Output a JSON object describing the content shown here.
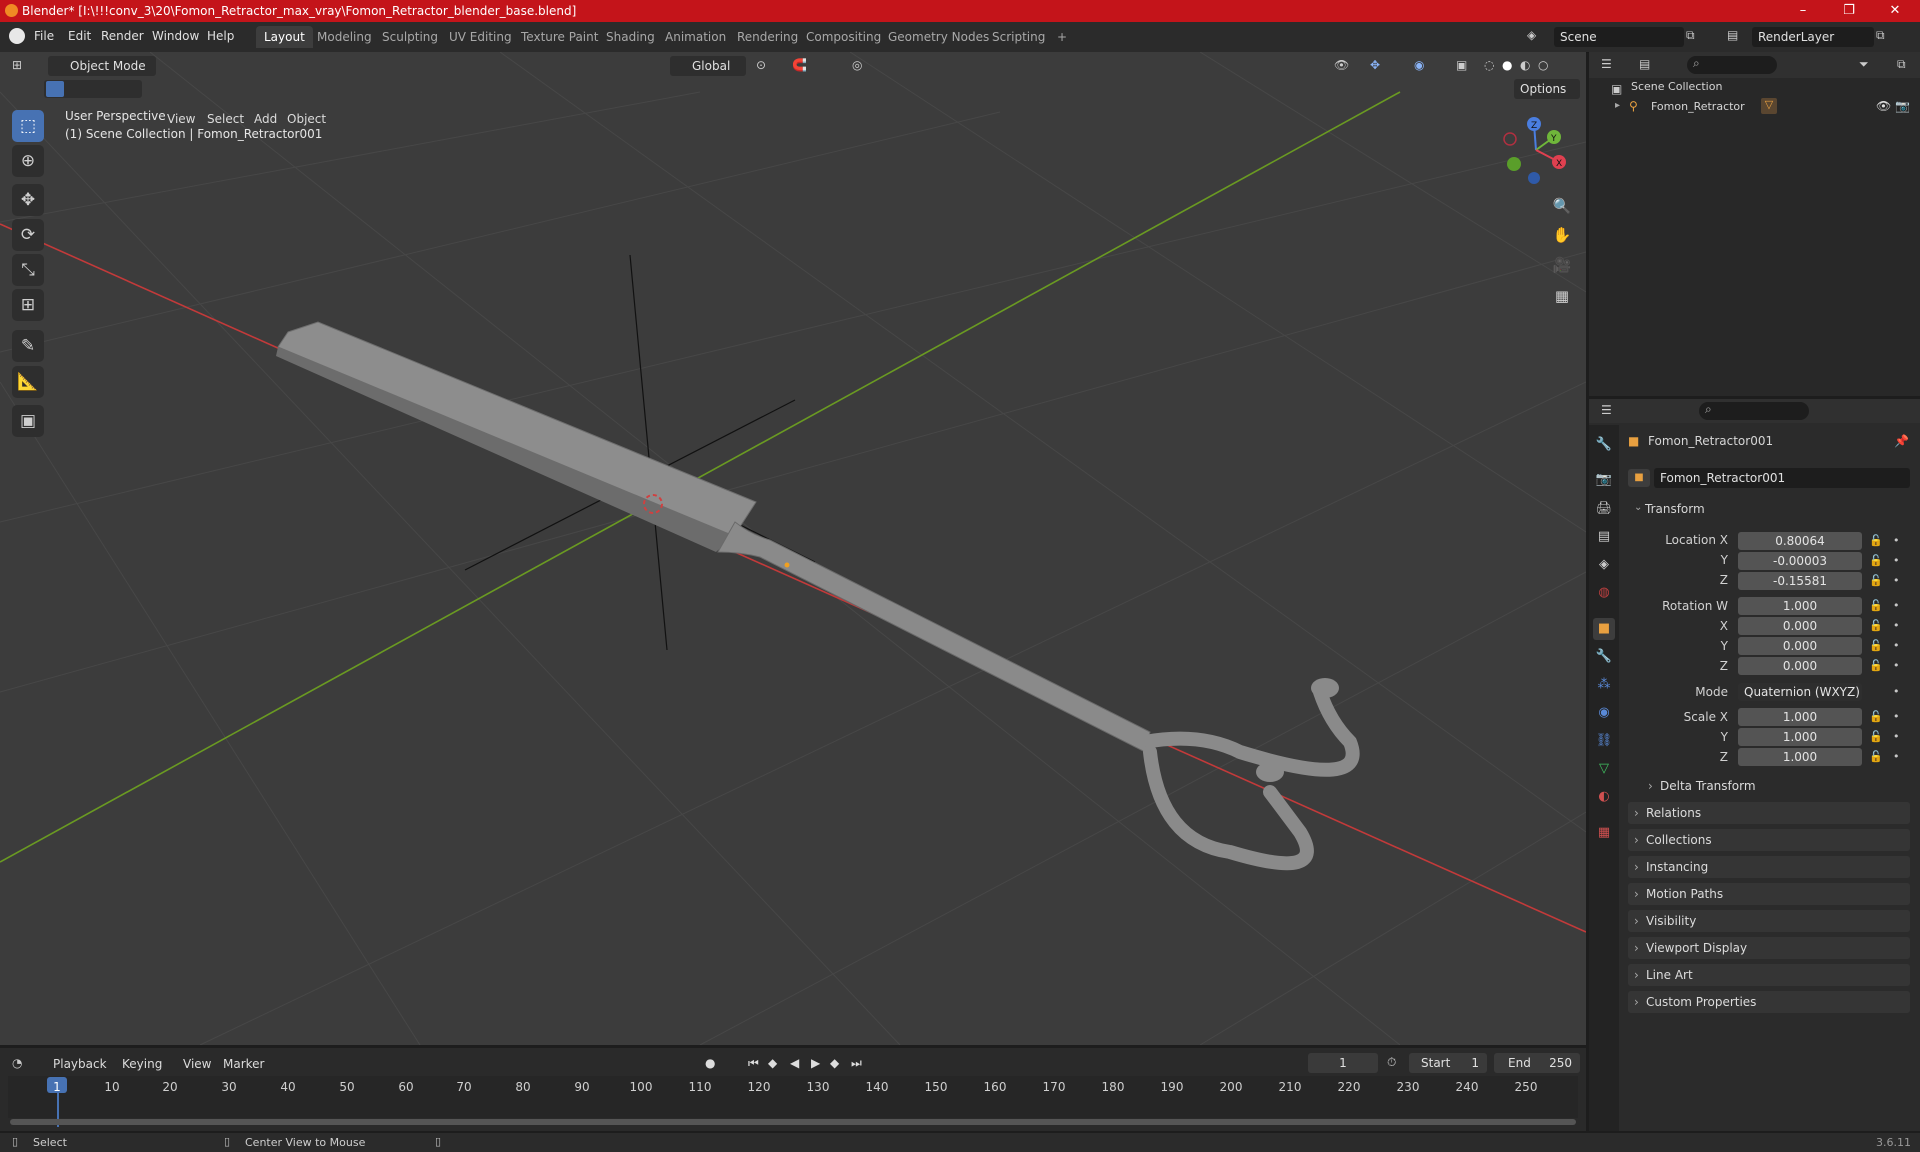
{
  "window": {
    "title": "Blender* [I:\\!!!conv_3\\20\\Fomon_Retractor_max_vray\\Fomon_Retractor_blender_base.blend]",
    "controls": [
      "–",
      "❐",
      "✕"
    ]
  },
  "menu": [
    "File",
    "Edit",
    "Render",
    "Window",
    "Help"
  ],
  "workspaces": [
    "Layout",
    "Modeling",
    "Sculpting",
    "UV Editing",
    "Texture Paint",
    "Shading",
    "Animation",
    "Rendering",
    "Compositing",
    "Geometry Nodes",
    "Scripting",
    "+"
  ],
  "scene": {
    "name": "Scene",
    "view_layer": "RenderLayer"
  },
  "viewport_header": {
    "mode": "Object Mode",
    "menus": [
      "View",
      "Select",
      "Add",
      "Object"
    ],
    "orientation": "Global",
    "options": "Options"
  },
  "viewport": {
    "perspective": "User Perspective",
    "collection_info": "(1) Scene Collection | Fomon_Retractor001",
    "gizmo_axes": {
      "x": "X",
      "y": "Y",
      "z": "Z"
    },
    "colors": {
      "bg": "#3c3c3c",
      "x_axis": "#c23a3a",
      "y_axis": "#6a9a22",
      "active_tool": "#4772b3"
    }
  },
  "tools": [
    "select-box",
    "cursor",
    "move",
    "rotate",
    "scale",
    "transform",
    "annotate",
    "measure",
    "add-cube"
  ],
  "outliner": {
    "root": "Scene Collection",
    "items": [
      {
        "name": "Fomon_Retractor"
      }
    ]
  },
  "properties": {
    "object_name": "Fomon_Retractor001",
    "datablock": "Fomon_Retractor001",
    "transform_header": "Transform",
    "location": {
      "label": "Location X",
      "x": "0.80064",
      "y": "-0.00003",
      "z": "-0.15581"
    },
    "rotation": {
      "label": "Rotation W",
      "w": "1.000",
      "x": "0.000",
      "y": "0.000",
      "z": "0.000"
    },
    "mode_label": "Mode",
    "mode": "Quaternion (WXYZ)",
    "scale": {
      "label": "Scale X",
      "x": "1.000",
      "y": "1.000",
      "z": "1.000"
    },
    "axis_labels": {
      "y": "Y",
      "z": "Z",
      "x": "X"
    },
    "delta": "Delta Transform",
    "panels": [
      "Relations",
      "Collections",
      "Instancing",
      "Motion Paths",
      "Visibility",
      "Viewport Display",
      "Line Art",
      "Custom Properties"
    ]
  },
  "timeline": {
    "menus": [
      "Playback",
      "Keying",
      "View",
      "Marker"
    ],
    "current_frame": "1",
    "start_label": "Start",
    "start": "1",
    "end_label": "End",
    "end": "250",
    "ruler": [
      "1",
      "10",
      "20",
      "30",
      "40",
      "50",
      "60",
      "70",
      "80",
      "90",
      "100",
      "110",
      "120",
      "130",
      "140",
      "150",
      "160",
      "170",
      "180",
      "190",
      "200",
      "210",
      "220",
      "230",
      "240",
      "250"
    ]
  },
  "status": {
    "select": "Select",
    "center": "Center View to Mouse",
    "version": "3.6.11"
  }
}
